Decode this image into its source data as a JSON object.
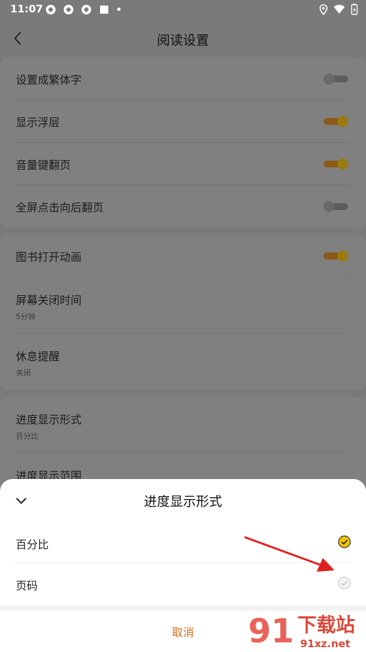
{
  "status_bar": {
    "time": "11:07",
    "icons": [
      "notification-app-icon",
      "notification-app-icon",
      "notification-app-icon",
      "notification-square-icon",
      "notification-dot-icon"
    ],
    "right_icons": [
      "location-icon",
      "wifi-icon",
      "battery-icon"
    ]
  },
  "header": {
    "title": "阅读设置",
    "back_icon": "chevron-left-icon"
  },
  "settings": {
    "group1": [
      {
        "label": "设置成繁体字",
        "toggle": false
      },
      {
        "label": "显示浮层",
        "toggle": true
      },
      {
        "label": "音量键翻页",
        "toggle": true
      },
      {
        "label": "全屏点击向后翻页",
        "toggle": false
      }
    ],
    "group2": [
      {
        "label": "图书打开动画",
        "toggle": true
      },
      {
        "label": "屏幕关闭时间",
        "sub": "5分钟"
      },
      {
        "label": "休息提醒",
        "sub": "关闭"
      }
    ],
    "group3": [
      {
        "label": "进度显示形式",
        "sub": "百分比"
      },
      {
        "label": "进度显示范围"
      }
    ]
  },
  "sheet": {
    "title": "进度显示形式",
    "collapse_icon": "chevron-down-icon",
    "options": [
      {
        "label": "百分比",
        "selected": true
      },
      {
        "label": "页码",
        "selected": false
      }
    ],
    "cancel_label": "取消"
  },
  "colors": {
    "accent": "#f4c400",
    "toggle_on_track": "#e07a10",
    "cancel": "#e06a1a",
    "arrow": "#e02020"
  },
  "watermark": {
    "mark": "91",
    "brand": "下载站",
    "domain": "91xz.net"
  }
}
